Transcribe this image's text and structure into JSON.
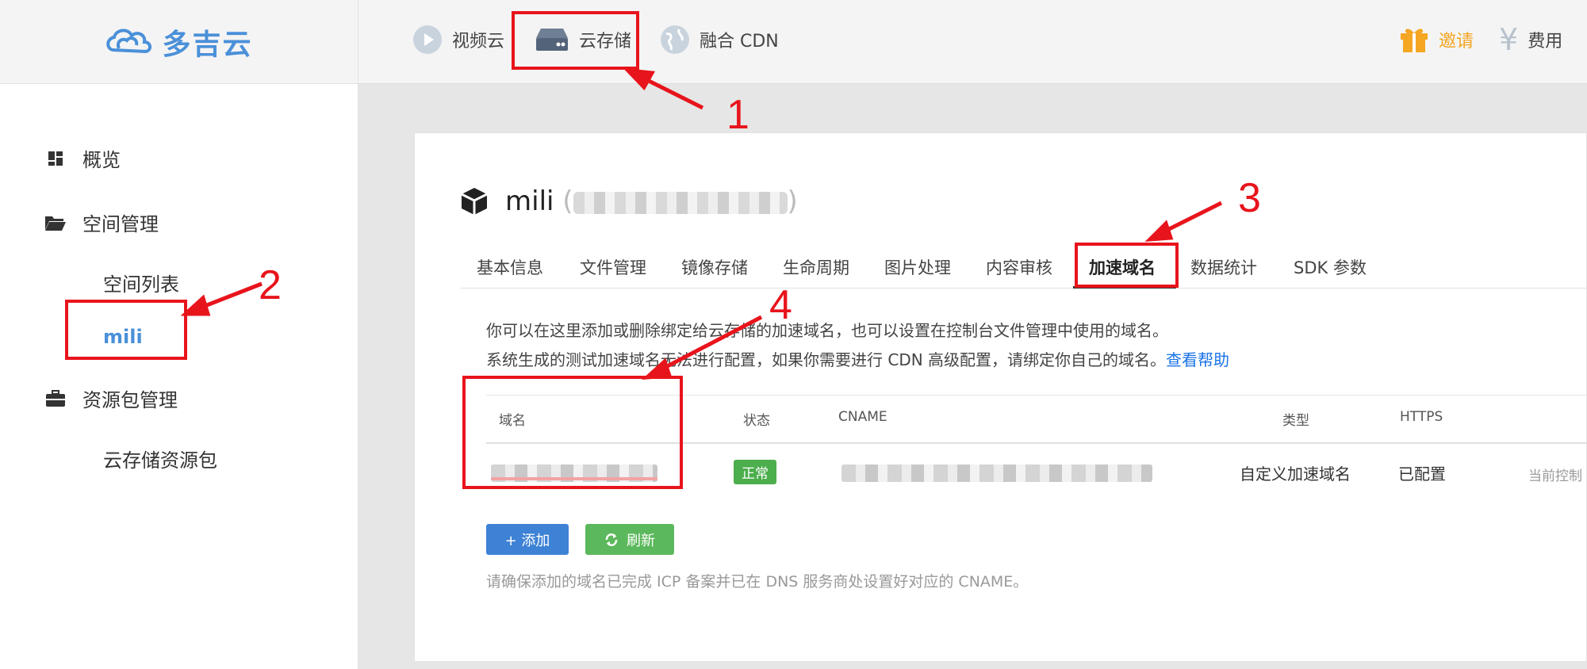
{
  "brand": {
    "name": "多吉云"
  },
  "topnav": [
    {
      "label": "视频云",
      "icon": "play-circle-icon"
    },
    {
      "label": "云存储",
      "icon": "storage-drive-icon"
    },
    {
      "label": "融合 CDN",
      "icon": "globe-icon"
    }
  ],
  "topright": {
    "invite_label": "邀请",
    "fee_label": "费用",
    "invite_icon": "gift-icon",
    "fee_icon": "yen-icon"
  },
  "sidebar": {
    "overview": "概览",
    "space_mgmt": "空间管理",
    "space_list": "空间列表",
    "current_bucket": "mili",
    "resource_pkg_mgmt": "资源包管理",
    "storage_pkg": "云存储资源包"
  },
  "bucket": {
    "name": "mili",
    "paren_open": "(",
    "paren_close": ")"
  },
  "tabs": [
    "基本信息",
    "文件管理",
    "镜像存储",
    "生命周期",
    "图片处理",
    "内容审核",
    "加速域名",
    "数据统计",
    "SDK 参数"
  ],
  "active_tab_index": 6,
  "info": {
    "line1": "你可以在这里添加或删除绑定给云存储的加速域名，也可以设置在控制台文件管理中使用的域名。",
    "line2": "系统生成的测试加速域名无法进行配置，如果你需要进行 CDN 高级配置，请绑定你自己的域名。",
    "help_link": "查看帮助"
  },
  "table": {
    "headers": {
      "domain": "域名",
      "status": "状态",
      "cname": "CNAME",
      "type": "类型",
      "https": "HTTPS"
    },
    "rows": [
      {
        "status": "正常",
        "type": "自定义加速域名",
        "https": "已配置",
        "action": "当前控制"
      }
    ]
  },
  "buttons": {
    "add": "+ 添加",
    "refresh": "刷新"
  },
  "note": "请确保添加的域名已完成 ICP 备案并已在 DNS 服务商处设置好对应的 CNAME。",
  "annotations": [
    "1",
    "2",
    "3",
    "4"
  ],
  "colors": {
    "accent": "#4a90d9",
    "annotation": "#e8141c",
    "success": "#4cae4c",
    "invite": "#f5a623"
  }
}
